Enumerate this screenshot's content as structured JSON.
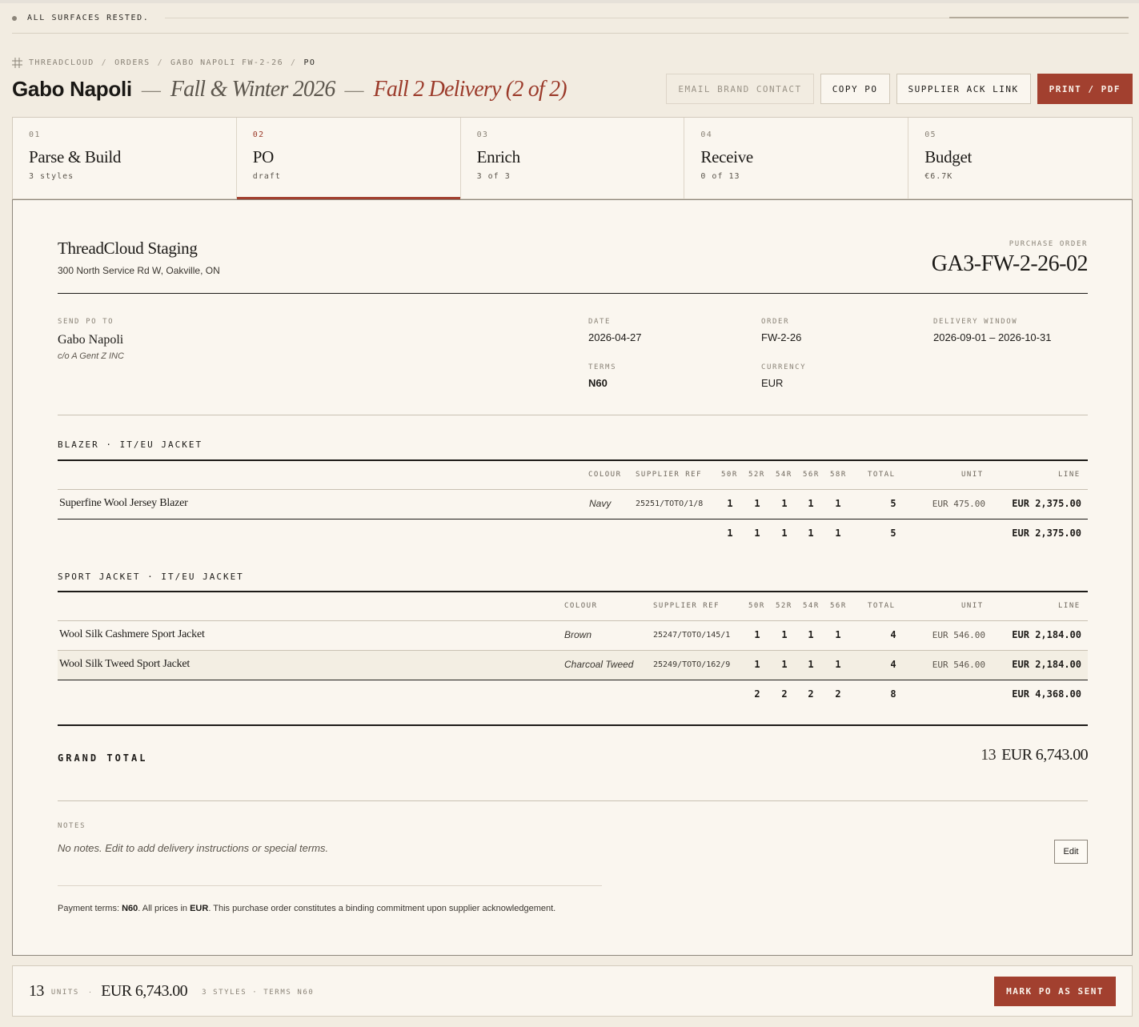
{
  "status": {
    "text": "ALL SURFACES RESTED."
  },
  "breadcrumb": [
    "THREADCLOUD",
    "ORDERS",
    "GABO NAPOLI FW-2-26",
    "PO"
  ],
  "header": {
    "brand": "Gabo Napoli",
    "season": "Fall & Winter 2026",
    "delivery": "Fall 2 Delivery (2 of 2)"
  },
  "actions": {
    "email": "EMAIL BRAND CONTACT",
    "copy": "COPY PO",
    "ack": "SUPPLIER ACK LINK",
    "print": "PRINT / PDF"
  },
  "steps": [
    {
      "num": "01",
      "name": "Parse & Build",
      "sub": "3 styles"
    },
    {
      "num": "02",
      "name": "PO",
      "sub": "draft"
    },
    {
      "num": "03",
      "name": "Enrich",
      "sub": "3 of 3"
    },
    {
      "num": "04",
      "name": "Receive",
      "sub": "0 of 13"
    },
    {
      "num": "05",
      "name": "Budget",
      "sub": "€6.7K"
    }
  ],
  "doc": {
    "company": "ThreadCloud Staging",
    "address": "300 North Service Rd W, Oakville, ON",
    "po_label": "PURCHASE ORDER",
    "po_number": "GA3-FW-2-26-02",
    "send_label": "SEND PO TO",
    "send_name": "Gabo Napoli",
    "send_care": "c/o A Gent Z INC",
    "date_label": "DATE",
    "date": "2026-04-27",
    "order_label": "ORDER",
    "order": "FW-2-26",
    "window_label": "DELIVERY WINDOW",
    "window": "2026-09-01 – 2026-10-31",
    "terms_label": "TERMS",
    "terms": "N60",
    "currency_label": "CURRENCY",
    "currency": "EUR"
  },
  "sections": [
    {
      "title": "BLAZER · IT/EU JACKET",
      "headers": {
        "colour": "COLOUR",
        "ref": "SUPPLIER REF",
        "sizes": [
          "50R",
          "52R",
          "54R",
          "56R",
          "58R"
        ],
        "total": "TOTAL",
        "unit": "UNIT",
        "line": "LINE"
      },
      "rows": [
        {
          "name": "Superfine Wool Jersey Blazer",
          "colour": "Navy",
          "ref": "25251/TOTO/1/8",
          "qty": [
            "1",
            "1",
            "1",
            "1",
            "1"
          ],
          "total": "5",
          "unit": "EUR 475.00",
          "line": "EUR 2,375.00"
        }
      ],
      "totals": {
        "qty": [
          "1",
          "1",
          "1",
          "1",
          "1"
        ],
        "total": "5",
        "line": "EUR 2,375.00"
      }
    },
    {
      "title": "SPORT JACKET · IT/EU JACKET",
      "headers": {
        "colour": "COLOUR",
        "ref": "SUPPLIER REF",
        "sizes": [
          "50R",
          "52R",
          "54R",
          "56R"
        ],
        "total": "TOTAL",
        "unit": "UNIT",
        "line": "LINE"
      },
      "rows": [
        {
          "name": "Wool Silk Cashmere Sport Jacket",
          "colour": "Brown",
          "ref": "25247/TOTO/145/1",
          "qty": [
            "1",
            "1",
            "1",
            "1"
          ],
          "total": "4",
          "unit": "EUR 546.00",
          "line": "EUR 2,184.00"
        },
        {
          "name": "Wool Silk Tweed Sport Jacket",
          "colour": "Charcoal Tweed",
          "ref": "25249/TOTO/162/9",
          "qty": [
            "1",
            "1",
            "1",
            "1"
          ],
          "total": "4",
          "unit": "EUR 546.00",
          "line": "EUR 2,184.00"
        }
      ],
      "totals": {
        "qty": [
          "2",
          "2",
          "2",
          "2"
        ],
        "total": "8",
        "line": "EUR 4,368.00"
      }
    }
  ],
  "grand": {
    "label": "GRAND TOTAL",
    "units": "13",
    "amount": "EUR 6,743.00"
  },
  "notes": {
    "label": "NOTES",
    "text": "No notes. Edit to add delivery instructions or special terms.",
    "edit": "Edit",
    "fine_prefix": "Payment terms: ",
    "fine_terms": "N60",
    "fine_mid": ". All prices in ",
    "fine_currency": "EUR",
    "fine_suffix": ". This purchase order constitutes a binding commitment upon supplier acknowledgement."
  },
  "footer": {
    "units": "13",
    "units_label": "UNITS",
    "amount": "EUR 6,743.00",
    "meta": "3 STYLES · TERMS N60",
    "mark_sent": "MARK PO AS SENT"
  }
}
